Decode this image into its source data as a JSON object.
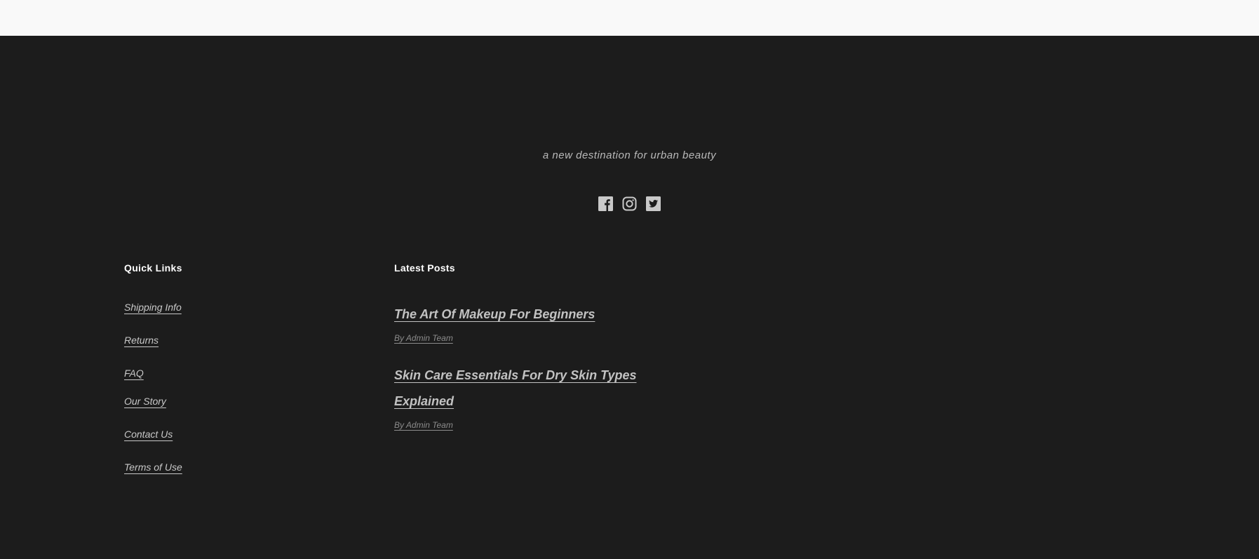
{
  "footer": {
    "tagline": "a new destination for urban beauty",
    "social": [
      {
        "name": "facebook-icon"
      },
      {
        "name": "instagram-icon"
      },
      {
        "name": "twitter-icon"
      }
    ],
    "quick_links": {
      "title": "Quick Links",
      "items": [
        {
          "label": "Shipping Info"
        },
        {
          "label": "Returns"
        },
        {
          "label": "FAQ"
        },
        {
          "label": "Our Story"
        },
        {
          "label": "Contact Us"
        },
        {
          "label": "Terms of Use"
        }
      ]
    },
    "latest_posts": {
      "title": "Latest Posts",
      "posts": [
        {
          "title": "The Art Of Makeup For Beginners",
          "meta": "By Admin Team"
        },
        {
          "title": "Skin Care Essentials For Dry Skin Types Explained",
          "meta": "By Admin Team"
        }
      ]
    }
  },
  "colors": {
    "topbar": "#f9f9f9",
    "footer_bg": "#1c1c1c",
    "heading": "#ffffff",
    "link": "#c8c8c8",
    "meta": "#8c8c8c"
  }
}
